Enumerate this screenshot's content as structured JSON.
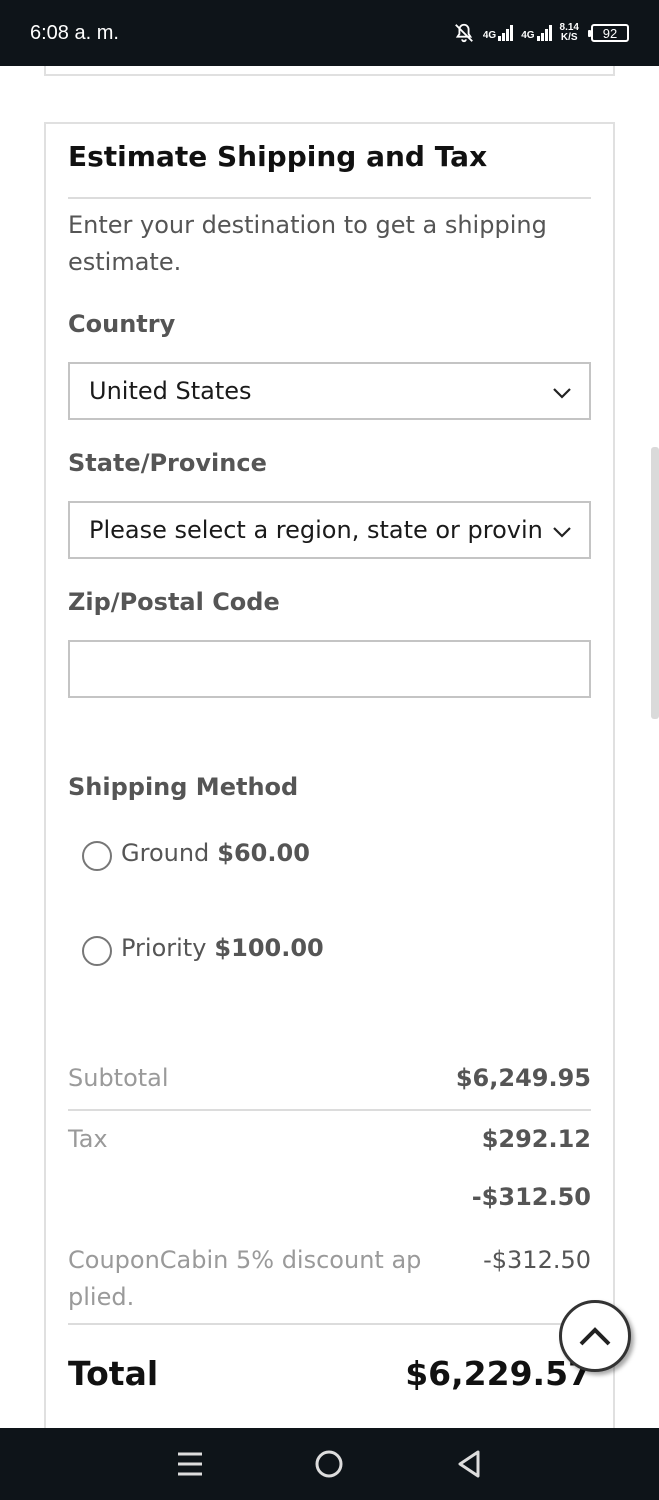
{
  "status_bar": {
    "time": "6:08 a. m.",
    "net1_label": "4G",
    "net2_label": "4G",
    "speed_value": "8.14",
    "speed_unit": "K/S",
    "battery": "92"
  },
  "estimate": {
    "title": "Estimate Shipping and Tax",
    "intro": "Enter your destination to get a shipping estimate.",
    "country_label": "Country",
    "country_value": "United States",
    "state_label": "State/Province",
    "state_value": "Please select a region, state or province.",
    "zip_label": "Zip/Postal Code",
    "zip_value": ""
  },
  "shipping": {
    "label": "Shipping Method",
    "options": [
      {
        "name": "Ground",
        "price": "$60.00"
      },
      {
        "name": "Priority",
        "price": "$100.00"
      }
    ]
  },
  "totals": {
    "subtotal_label": "Subtotal",
    "subtotal_value": "$6,249.95",
    "tax_label": "Tax",
    "tax_value": "$292.12",
    "discount_value": "-$312.50",
    "coupon_label": "CouponCabin 5% discount ap plied.",
    "coupon_value": "-$312.50",
    "total_label": "Total",
    "total_value": "$6,229.57"
  },
  "colors": {
    "status_bg": "#0e1419",
    "border": "#e0e0e0",
    "muted_text": "#555555"
  }
}
